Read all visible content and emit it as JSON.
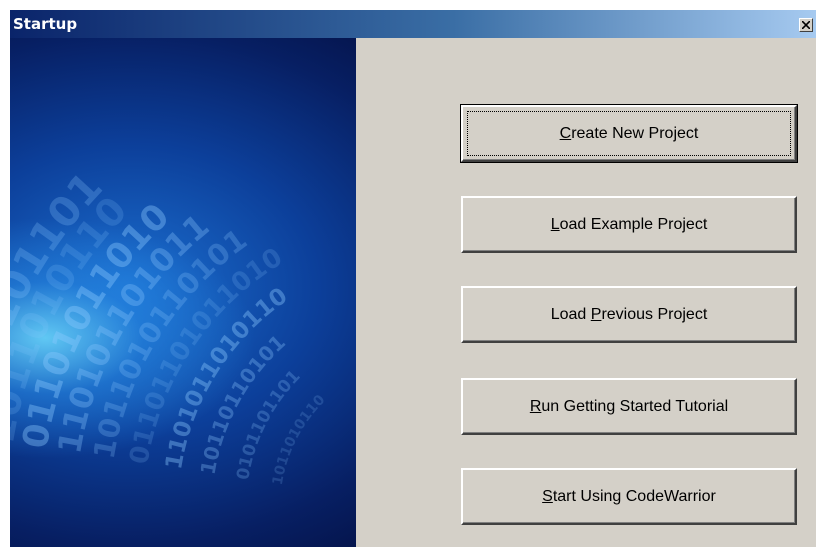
{
  "window": {
    "title": "Startup",
    "close_label": "Close"
  },
  "banner": {
    "digit_rows": [
      "1011010110",
      "0101101101",
      "10110110101",
      "1101011010110",
      "01101101011010",
      "1011010110101",
      "110101101011",
      "01101011010",
      "1011010110",
      "0110101101"
    ]
  },
  "actions": [
    {
      "prefix": "",
      "mnemonic": "C",
      "suffix": "reate New Project",
      "is_default": true
    },
    {
      "prefix": "",
      "mnemonic": "L",
      "suffix": "oad Example Project",
      "is_default": false
    },
    {
      "prefix": "Load ",
      "mnemonic": "P",
      "suffix": "revious Project",
      "is_default": false
    },
    {
      "prefix": "",
      "mnemonic": "R",
      "suffix": "un Getting Started Tutorial",
      "is_default": false
    },
    {
      "prefix": "",
      "mnemonic": "S",
      "suffix": "tart Using CodeWarrior",
      "is_default": false
    }
  ],
  "colors": {
    "titlebar_start": "#0a246a",
    "titlebar_end": "#a6caf0",
    "dialog_face": "#d4d0c8",
    "banner_blue": "#0c3f9a",
    "banner_glow": "#6edcff"
  }
}
